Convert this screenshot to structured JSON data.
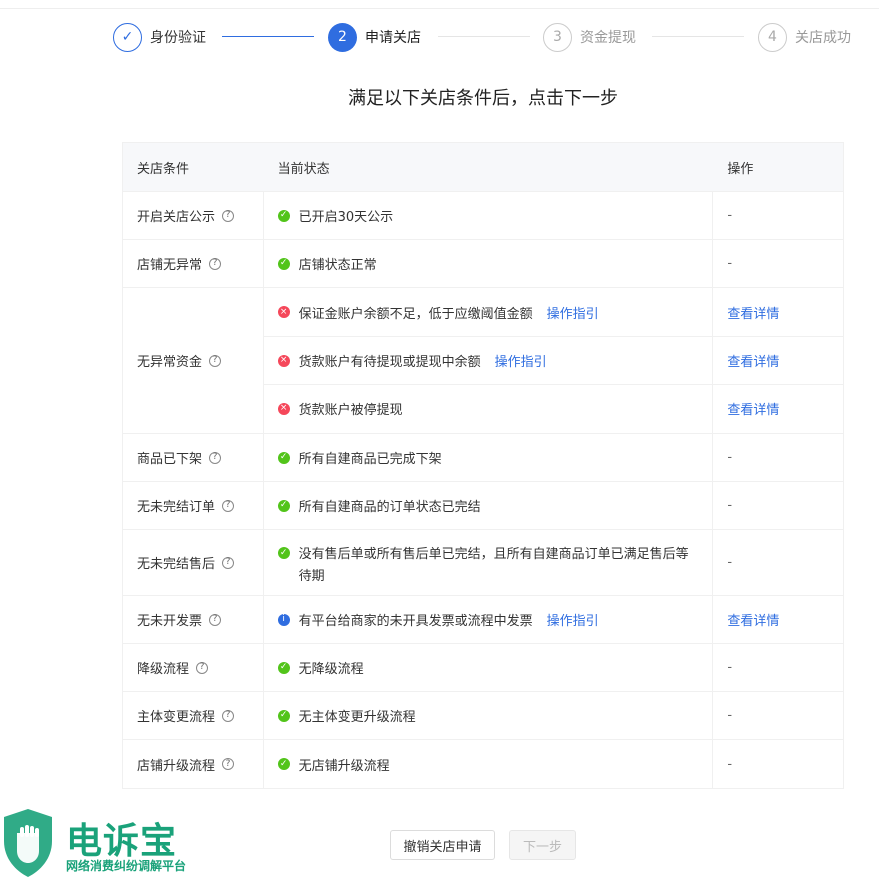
{
  "steps": [
    {
      "number": "✓",
      "label": "身份验证",
      "state": "done"
    },
    {
      "number": "2",
      "label": "申请关店",
      "state": "active"
    },
    {
      "number": "3",
      "label": "资金提现",
      "state": "todo"
    },
    {
      "number": "4",
      "label": "关店成功",
      "state": "todo"
    }
  ],
  "headline": "满足以下关店条件后，点击下一步",
  "table": {
    "headers": [
      "关店条件",
      "当前状态",
      "操作"
    ],
    "rows": [
      {
        "condition": "开启关店公示",
        "items": [
          {
            "status": "ok",
            "text": "已开启30天公示",
            "guide": "",
            "action": "-"
          }
        ]
      },
      {
        "condition": "店铺无异常",
        "items": [
          {
            "status": "ok",
            "text": "店铺状态正常",
            "guide": "",
            "action": "-"
          }
        ]
      },
      {
        "condition": "无异常资金",
        "items": [
          {
            "status": "err",
            "text": "保证金账户余额不足，低于应缴阈值金额",
            "guide": "操作指引",
            "action": "查看详情"
          },
          {
            "status": "err",
            "text": "货款账户有待提现或提现中余额",
            "guide": "操作指引",
            "action": "查看详情"
          },
          {
            "status": "err",
            "text": "货款账户被停提现",
            "guide": "",
            "action": "查看详情"
          }
        ]
      },
      {
        "condition": "商品已下架",
        "items": [
          {
            "status": "ok",
            "text": "所有自建商品已完成下架",
            "guide": "",
            "action": "-"
          }
        ]
      },
      {
        "condition": "无未完结订单",
        "items": [
          {
            "status": "ok",
            "text": "所有自建商品的订单状态已完结",
            "guide": "",
            "action": "-"
          }
        ]
      },
      {
        "condition": "无未完结售后",
        "items": [
          {
            "status": "ok",
            "text": "没有售后单或所有售后单已完结，且所有自建商品订单已满足售后等待期",
            "guide": "",
            "action": "-"
          }
        ]
      },
      {
        "condition": "无未开发票",
        "items": [
          {
            "status": "info",
            "text": "有平台给商家的未开具发票或流程中发票",
            "guide": "操作指引",
            "action": "查看详情"
          }
        ]
      },
      {
        "condition": "降级流程",
        "items": [
          {
            "status": "ok",
            "text": "无降级流程",
            "guide": "",
            "action": "-"
          }
        ]
      },
      {
        "condition": "主体变更流程",
        "items": [
          {
            "status": "ok",
            "text": "无主体变更升级流程",
            "guide": "",
            "action": "-"
          }
        ]
      },
      {
        "condition": "店铺升级流程",
        "items": [
          {
            "status": "ok",
            "text": "无店铺升级流程",
            "guide": "",
            "action": "-"
          }
        ]
      }
    ]
  },
  "buttons": {
    "cancel": "撤销关店申请",
    "next": "下一步"
  },
  "watermark": {
    "brand": "电诉宝",
    "subtitle": "网络消费纠纷调解平台"
  },
  "colors": {
    "primary": "#2f6de0",
    "success": "#52c41a",
    "error": "#f5475a",
    "brand_green": "#1aa27a"
  }
}
